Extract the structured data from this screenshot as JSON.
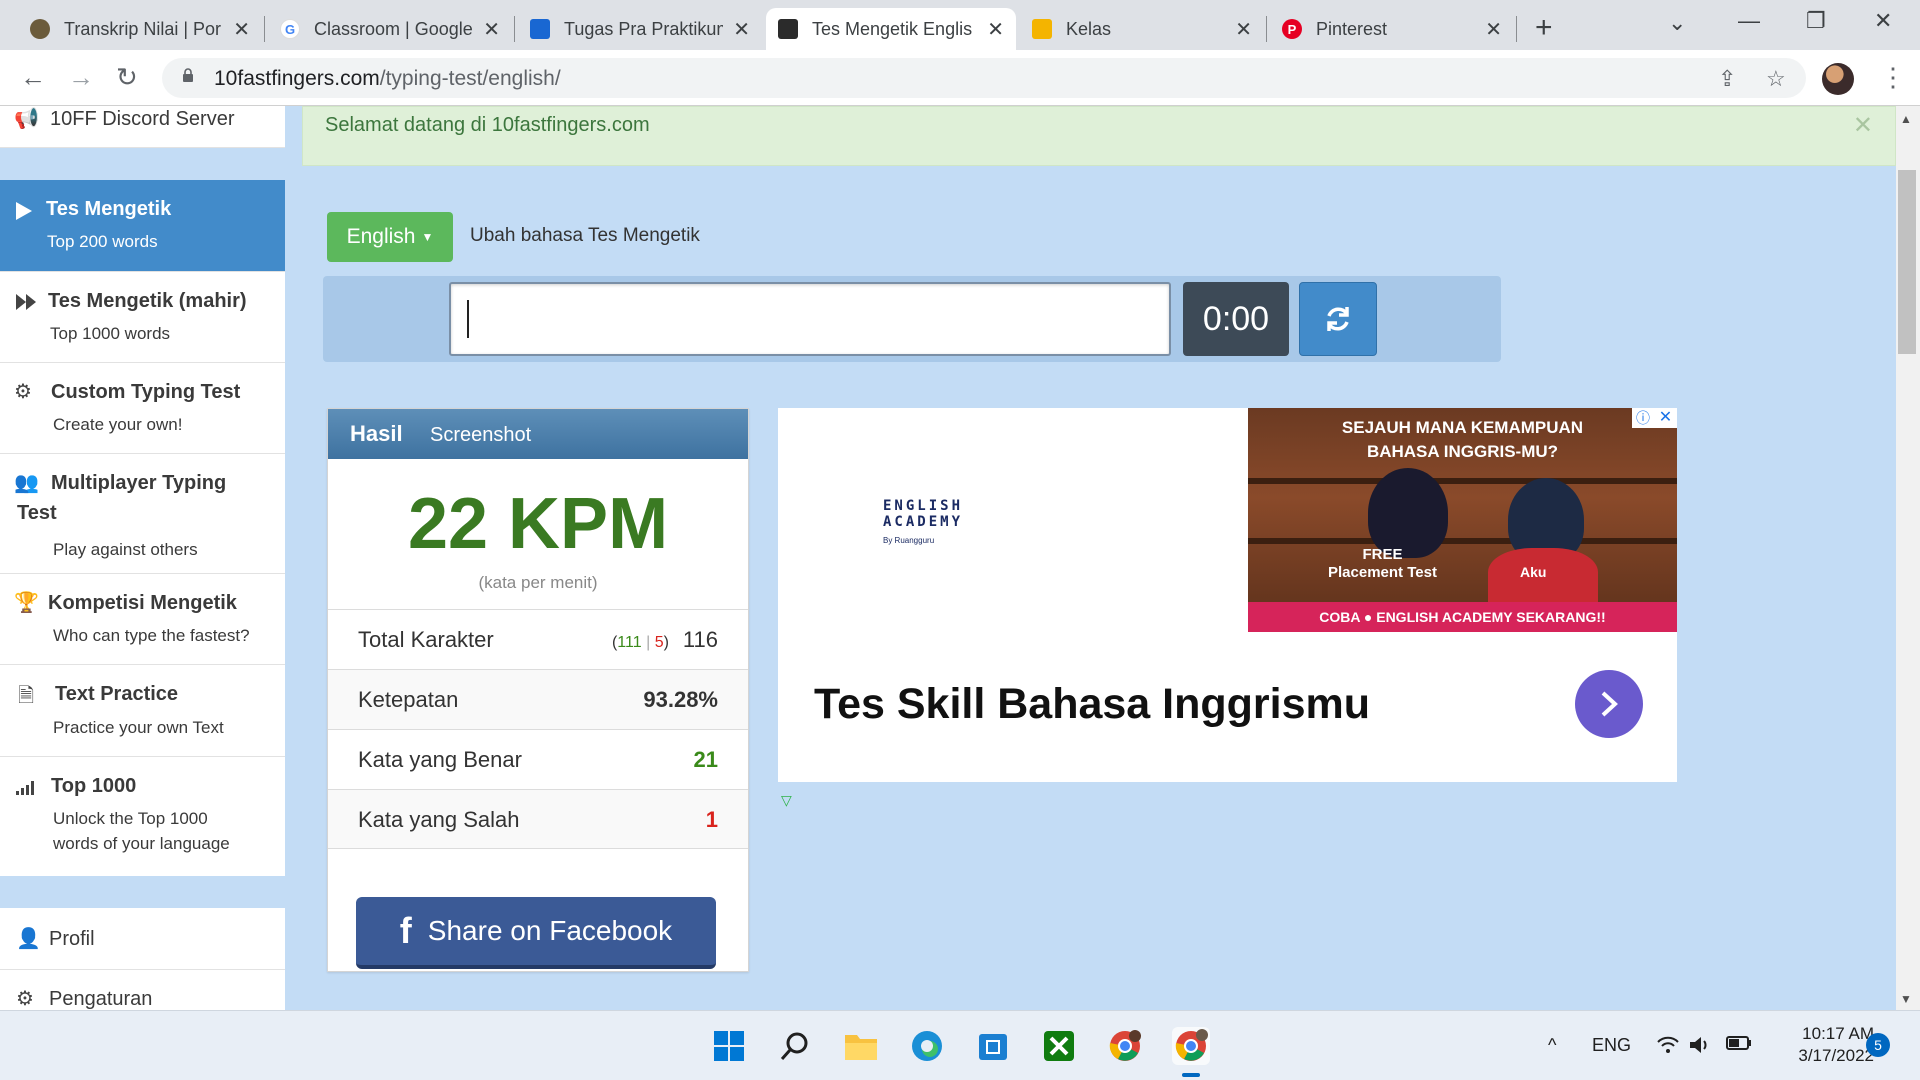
{
  "browser": {
    "tabs": [
      {
        "label": "Transkrip Nilai | Por",
        "favicon": "university-icon",
        "color": "#6b5b3b"
      },
      {
        "label": "Classroom | Google",
        "favicon": "google-icon",
        "color": "#4285f4"
      },
      {
        "label": "Tugas Pra Praktikum",
        "favicon": "classroom-icon",
        "color": "#1967d2"
      },
      {
        "label": "Tes Mengetik Englis",
        "favicon": "10ff-icon",
        "color": "#2b2b2b"
      },
      {
        "label": "Kelas",
        "favicon": "classroom-icon",
        "color": "#f4b400"
      },
      {
        "label": "Pinterest",
        "favicon": "pinterest-icon",
        "color": "#e60023"
      }
    ],
    "url_domain": "10fastfingers.com",
    "url_path": "/typing-test/english/"
  },
  "sidebar": {
    "top_item": "10FF Discord Server",
    "items": [
      {
        "title": "Tes Mengetik",
        "sub": "Top 200 words",
        "icon": "play-icon"
      },
      {
        "title": "Tes Mengetik (mahir)",
        "sub": "Top 1000 words",
        "icon": "fast-forward-icon"
      },
      {
        "title": "Custom Typing Test",
        "sub": "Create your own!",
        "icon": "gears-icon"
      },
      {
        "title": "Multiplayer Typing",
        "title2": "Test",
        "sub": "Play against others",
        "icon": "users-icon"
      },
      {
        "title": "Kompetisi Mengetik",
        "sub": "Who can type the fastest?",
        "icon": "trophy-icon"
      },
      {
        "title": "Text Practice",
        "sub": "Practice your own Text",
        "icon": "document-icon"
      },
      {
        "title": "Top 1000",
        "sub": "Unlock the Top 1000",
        "sub2": "words of your language",
        "icon": "signal-icon"
      }
    ],
    "profile": "Profil",
    "settings": "Pengaturan"
  },
  "welcome": {
    "message": "Selamat datang di 10fastfingers.com"
  },
  "language": {
    "selected": "English",
    "label": "Ubah bahasa Tes Mengetik"
  },
  "test": {
    "timer": "0:00",
    "input_value": ""
  },
  "result": {
    "tab_active": "Hasil",
    "tab_other": "Screenshot",
    "wpm": "22 KPM",
    "wpm_sub": "(kata per menit)",
    "rows": {
      "keystrokes_label": "Total Karakter",
      "keystrokes_correct": "111",
      "keystrokes_sep": "|",
      "keystrokes_wrong": "5",
      "keystrokes_total": "116",
      "accuracy_label": "Ketepatan",
      "accuracy_value": "93.28%",
      "correct_label": "Kata yang Benar",
      "correct_value": "21",
      "wrong_label": "Kata yang Salah",
      "wrong_value": "1"
    },
    "share": "Share on Facebook"
  },
  "ad": {
    "logo_line1": "ENGLISH",
    "logo_line2": "ACADEMY",
    "logo_line3": "By Ruangguru",
    "banner_line1": "SEJAUH MANA KEMAMPUAN",
    "banner_line2": "BAHASA INGGRIS-MU?",
    "banner_free": "FREE",
    "banner_placement": "Placement Test",
    "banner_aku": "Aku",
    "banner_bottom": "COBA ● ENGLISH ACADEMY SEKARANG!!",
    "title": "Tes Skill Bahasa Inggrismu",
    "close": "✕",
    "info": "ⓘ"
  },
  "taskbar": {
    "lang": "ENG",
    "time": "10:17 AM",
    "date": "3/17/2022",
    "notifications": "5"
  }
}
